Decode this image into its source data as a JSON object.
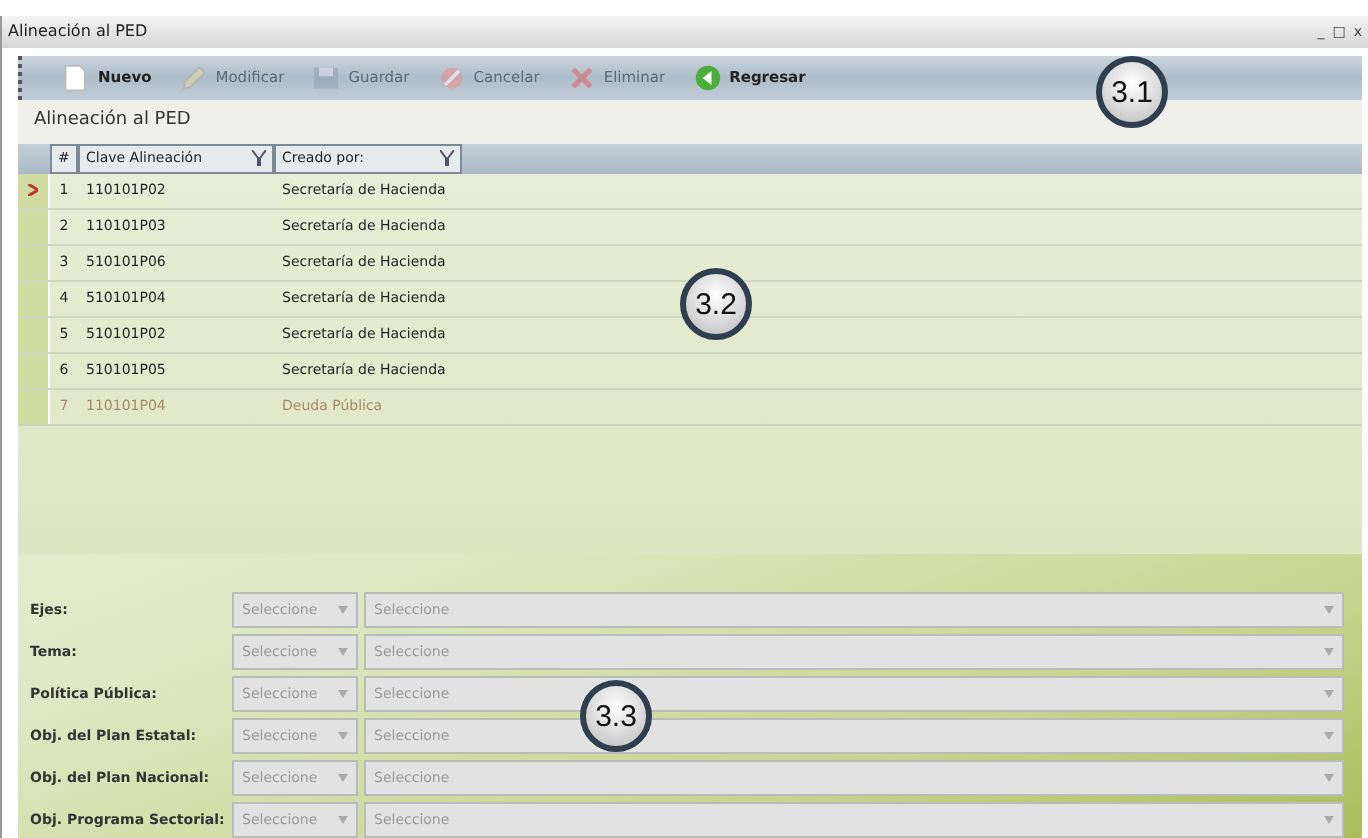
{
  "window": {
    "title": "Alineación al PED",
    "controls": [
      "_",
      "□",
      "x"
    ]
  },
  "toolbar": [
    {
      "label": "Nuevo",
      "disabled": false
    },
    {
      "label": "Modificar",
      "disabled": true
    },
    {
      "label": "Guardar",
      "disabled": true
    },
    {
      "label": "Cancelar",
      "disabled": true
    },
    {
      "label": "Eliminar",
      "disabled": true
    },
    {
      "label": "Regresar",
      "disabled": false
    }
  ],
  "section_title": "Alineación al PED",
  "table": {
    "columns": [
      "#",
      "Clave Alineación",
      "Creado por:"
    ],
    "rows": [
      {
        "index": "1",
        "clave": "110101P02",
        "creado_por": "Secretaría de Hacienda",
        "selected": true,
        "disabled": false
      },
      {
        "index": "2",
        "clave": "110101P03",
        "creado_por": "Secretaría de Hacienda",
        "selected": false,
        "disabled": false
      },
      {
        "index": "3",
        "clave": "510101P06",
        "creado_por": "Secretaría de Hacienda",
        "selected": false,
        "disabled": false
      },
      {
        "index": "4",
        "clave": "510101P04",
        "creado_por": "Secretaría de Hacienda",
        "selected": false,
        "disabled": false
      },
      {
        "index": "5",
        "clave": "510101P02",
        "creado_por": "Secretaría de Hacienda",
        "selected": false,
        "disabled": false
      },
      {
        "index": "6",
        "clave": "510101P05",
        "creado_por": "Secretaría de Hacienda",
        "selected": false,
        "disabled": false
      },
      {
        "index": "7",
        "clave": "110101P04",
        "creado_por": "Deuda Pública",
        "selected": false,
        "disabled": true
      }
    ]
  },
  "form": [
    {
      "label": "Ejes:",
      "code_placeholder": "Seleccione",
      "name_placeholder": "Seleccione"
    },
    {
      "label": "Tema:",
      "code_placeholder": "Seleccione",
      "name_placeholder": "Seleccione"
    },
    {
      "label": "Política Pública:",
      "code_placeholder": "Seleccione",
      "name_placeholder": "Seleccione"
    },
    {
      "label": "Obj. del Plan Estatal:",
      "code_placeholder": "Seleccione",
      "name_placeholder": "Seleccione"
    },
    {
      "label": "Obj. del Plan Nacional:",
      "code_placeholder": "Seleccione",
      "name_placeholder": "Seleccione"
    },
    {
      "label": "Obj. Programa Sectorial:",
      "code_placeholder": "Seleccione",
      "name_placeholder": "Seleccione"
    }
  ],
  "callouts": [
    "3.1",
    "3.2",
    "3.3"
  ]
}
